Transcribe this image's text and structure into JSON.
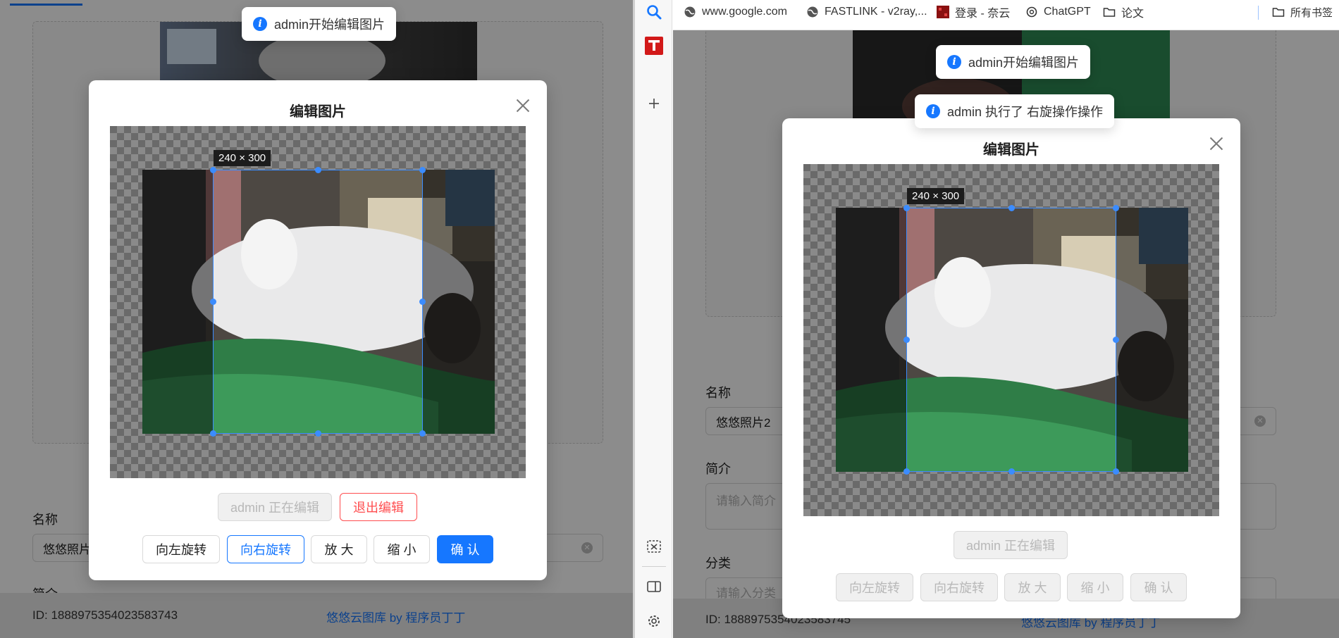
{
  "left": {
    "form": {
      "name_label": "名称",
      "name_value": "悠悠照片",
      "intro_label_partial": "简介"
    },
    "footer": {
      "id_text": "ID: 1888975354023583743",
      "link_text": "悠悠云图库 by 程序员丁丁"
    },
    "toast": "admin开始编辑图片",
    "modal": {
      "title": "编辑图片",
      "crop_size": "240 × 300",
      "editing_status": "admin 正在编辑",
      "exit_edit": "退出编辑",
      "rotate_left": "向左旋转",
      "rotate_right": "向右旋转",
      "zoom_in": "放 大",
      "zoom_out": "缩 小",
      "confirm": "确 认"
    }
  },
  "right": {
    "bookmarks": [
      {
        "label": "www.google.com",
        "icon": "globe-icon"
      },
      {
        "label": "FASTLINK - v2ray,...",
        "icon": "globe-icon"
      },
      {
        "label": "登录 - 奈云",
        "icon": "site-logo-icon"
      },
      {
        "label": "ChatGPT",
        "icon": "chatgpt-icon"
      },
      {
        "label": "论文",
        "icon": "folder-icon"
      },
      {
        "label": "所有书签",
        "icon": "folder-icon"
      }
    ],
    "form": {
      "name_label": "名称",
      "name_value": "悠悠照片2",
      "intro_label": "简介",
      "intro_placeholder": "请输入简介",
      "category_label": "分类",
      "category_placeholder": "请输入分类"
    },
    "footer": {
      "id_text": "ID: 1888975354023583745",
      "link_text": "悠悠云图库 by 程序员丁丁"
    },
    "toasts": [
      "admin开始编辑图片",
      "admin 执行了 右旋操作操作"
    ],
    "modal": {
      "title": "编辑图片",
      "crop_size": "240 × 300",
      "editing_status": "admin 正在编辑",
      "rotate_left": "向左旋转",
      "rotate_right": "向右旋转",
      "zoom_in": "放 大",
      "zoom_out": "缩 小",
      "confirm": "确 认"
    }
  },
  "colors": {
    "primary": "#1677ff",
    "danger": "#ff4d4f",
    "mask": "rgba(0,0,0,0.45)"
  }
}
